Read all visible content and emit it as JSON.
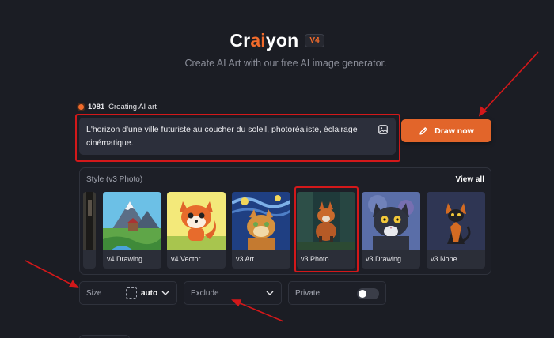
{
  "header": {
    "logo_pre": "Cr",
    "logo_ai": "ai",
    "logo_post": "yon",
    "version": "V4",
    "subtitle": "Create AI Art with our free AI image generator."
  },
  "status": {
    "count": "1081",
    "label": "Creating AI art"
  },
  "prompt": {
    "text": "L'horizon d'une ville futuriste au coucher du soleil, photoréaliste, éclairage cinématique.",
    "image_icon": "image-icon"
  },
  "draw_button": {
    "label": "Draw now",
    "icon": "pencil-icon"
  },
  "style_panel": {
    "title": "Style (v3 Photo)",
    "view_all": "View all",
    "selected": "v3 Photo",
    "cards": [
      {
        "label": "v4 Drawing"
      },
      {
        "label": "v4 Vector"
      },
      {
        "label": "v3 Art"
      },
      {
        "label": "v3 Photo"
      },
      {
        "label": "v3 Drawing"
      },
      {
        "label": "v3 None"
      }
    ]
  },
  "options": {
    "size_label": "Size",
    "size_value": "auto",
    "exclude_label": "Exclude",
    "private_label": "Private",
    "private_on": false
  },
  "colors": {
    "accent": "#e2652a",
    "background": "#1b1d24",
    "annotation": "#d3181a"
  }
}
